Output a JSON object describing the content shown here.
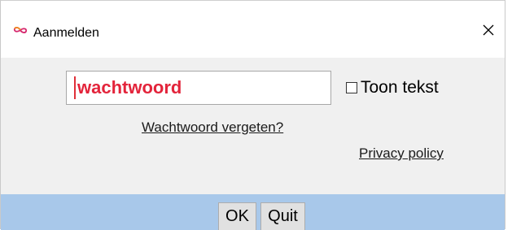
{
  "window": {
    "title": "Aanmelden",
    "app_icon": "infinity-logo-icon",
    "close_label": "✕"
  },
  "login": {
    "password_placeholder": "wachtwoord",
    "password_value": "",
    "show_text_label": "Toon tekst",
    "show_text_checked": false,
    "forgot_password_label": "Wachtwoord vergeten?",
    "privacy_label": "Privacy policy"
  },
  "buttons": {
    "ok_label": "OK",
    "quit_label": "Quit"
  },
  "colors": {
    "accent_text": "#e3243b",
    "button_bar": "#a8c8ea",
    "dialog_bg": "#f0f0f0",
    "logo_orange": "#f08a24",
    "logo_magenta": "#d6286e"
  }
}
